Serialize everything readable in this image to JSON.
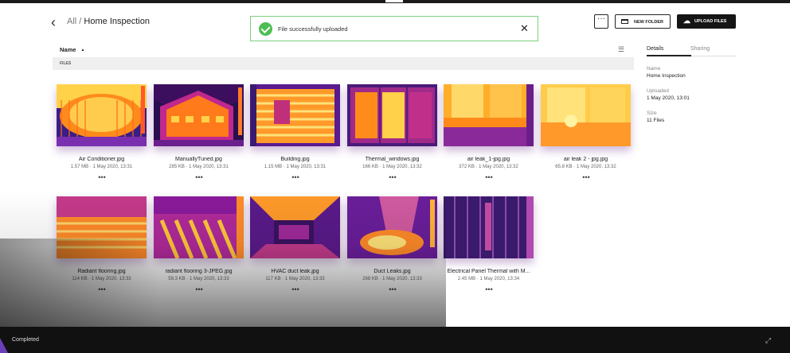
{
  "header": {
    "back_icon": "chevron-left-icon",
    "breadcrumb_root": "All",
    "breadcrumb_sep": "/",
    "breadcrumb_current": "Home Inspection"
  },
  "toast": {
    "message": "File successfully uploaded",
    "status_icon": "check-circle-icon",
    "close_label": "✕",
    "accent": "#4bbf53"
  },
  "toolbar": {
    "more_label": "···",
    "new_folder_label": "NEW FOLDER",
    "upload_label": "UPLOAD FILES"
  },
  "list": {
    "sort_column": "Name",
    "sort_arrow": "▲",
    "section_label": "FILES",
    "view_icon": "list-view-icon"
  },
  "files": [
    {
      "name": "Air Conditioner.jpg",
      "meta": "1.57 MB · 1 May 2020, 13:31",
      "more": "•••"
    },
    {
      "name": "ManuallyTuned.jpg",
      "meta": "285 KB · 1 May 2020, 13:31",
      "more": "•••"
    },
    {
      "name": "Building.jpg",
      "meta": "1.15 MB · 1 May 2020, 13:31",
      "more": "•••"
    },
    {
      "name": "Thermal_windows.jpg",
      "meta": "166 KB · 1 May 2020, 13:32",
      "more": "•••"
    },
    {
      "name": "air leak_1-jpg.jpg",
      "meta": "372 KB · 1 May 2020, 13:32",
      "more": "•••"
    },
    {
      "name": "air leak 2 - jpg.jpg",
      "meta": "65.8 KB · 1 May 2020, 13:32",
      "more": "•••"
    },
    {
      "name": "Radiant flooring.jpg",
      "meta": "114 KB · 1 May 2020, 13:33",
      "more": "•••"
    },
    {
      "name": "radiant flooring 3-JPEG.jpg",
      "meta": "59.3 KB · 1 May 2020, 13:33",
      "more": "•••"
    },
    {
      "name": "HVAC duct leak.jpg",
      "meta": "117 KB · 1 May 2020, 13:33",
      "more": "•••"
    },
    {
      "name": "Duct Leaks.jpg",
      "meta": "268 KB · 1 May 2020, 13:33",
      "more": "•••"
    },
    {
      "name": "Electrical Panel Thermal with M...",
      "meta": "2.45 MB · 1 May 2020, 13:34",
      "more": "•••"
    }
  ],
  "details": {
    "tab_details": "Details",
    "tab_sharing": "Sharing",
    "name_label": "Name",
    "name_value": "Home Inspection",
    "uploaded_label": "Uploaded",
    "uploaded_value": "1 May 2020, 13:01",
    "size_label": "Size",
    "size_value": "11 Files"
  },
  "status": {
    "text": "Completed",
    "expand_icon": "expand-icon"
  }
}
